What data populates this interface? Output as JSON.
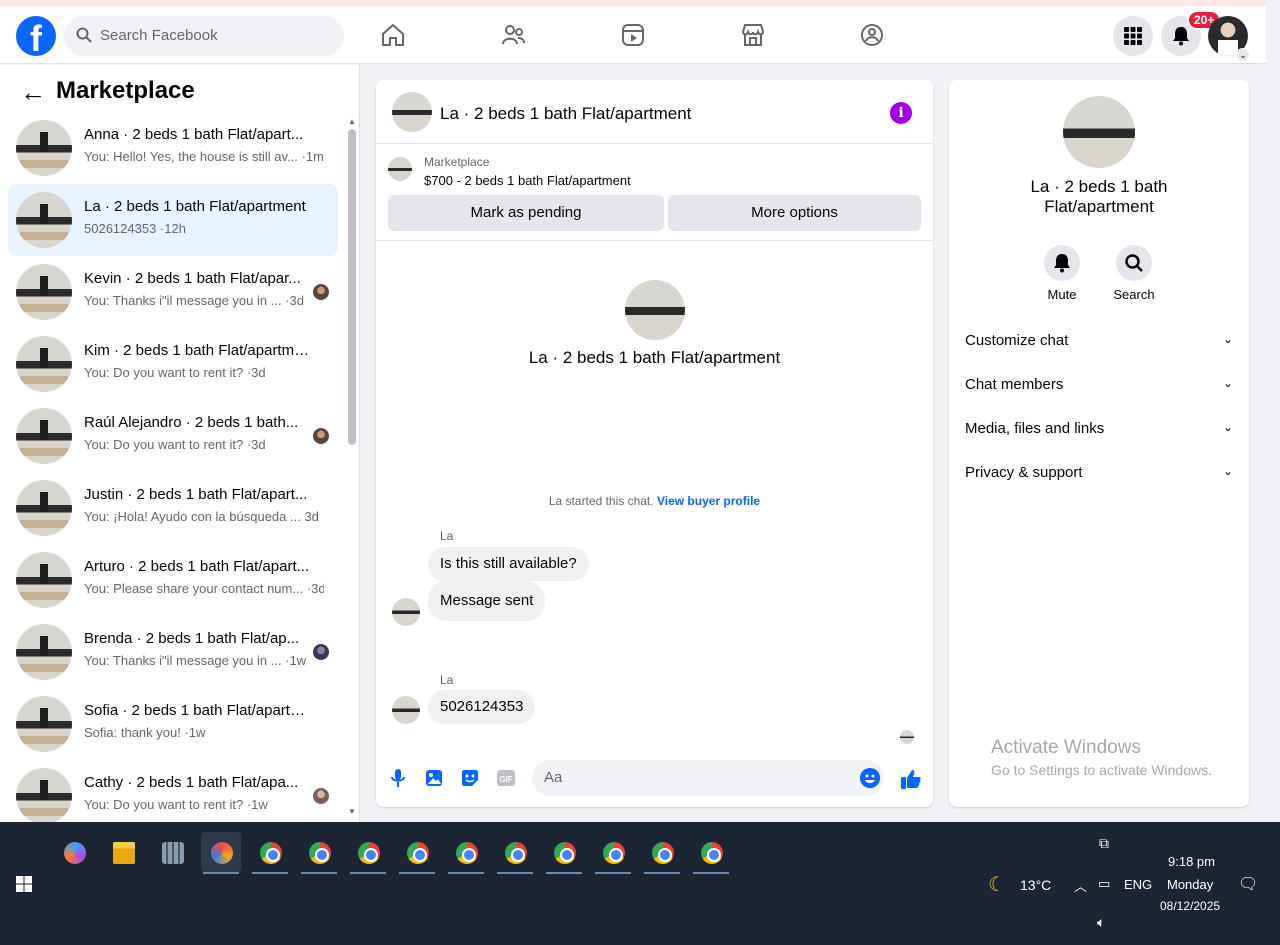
{
  "header": {
    "logo": "f",
    "search_placeholder": "Search Facebook",
    "nav_icons": [
      "home-icon",
      "friends-icon",
      "video-icon",
      "marketplace-icon",
      "groups-icon"
    ],
    "notification_badge": "20+",
    "accent": "#0866ff"
  },
  "sidebar": {
    "title": "Marketplace",
    "conversations": [
      {
        "name": "Anna · 2 beds 1 bath Flat/apart...",
        "preview": "You: Hello! Yes, the house is still av... ·1m",
        "active": false
      },
      {
        "name": "La · 2 beds 1 bath Flat/apartment",
        "preview": "5026124353 ·12h",
        "active": true
      },
      {
        "name": "Kevin · 2 beds 1 bath Flat/apar...",
        "preview": "You: Thanks i\"il message you in ... ·3d",
        "active": false
      },
      {
        "name": "Kim · 2 beds 1 bath Flat/apartme...",
        "preview": "You: Do you want to rent it? ·3d",
        "active": false
      },
      {
        "name": "Raúl Alejandro · 2 beds 1 bath...",
        "preview": "You: Do you want to rent it? ·3d",
        "active": false
      },
      {
        "name": "Justin · 2 beds 1 bath Flat/apart...",
        "preview": "You: ¡Hola! Ayudo con la búsqueda ... 3d",
        "active": false
      },
      {
        "name": "Arturo · 2 beds 1 bath Flat/apart...",
        "preview": "You: Please share your contact num... ·3d",
        "active": false
      },
      {
        "name": "Brenda · 2 beds 1 bath Flat/ap...",
        "preview": "You: Thanks i\"il message you in ... ·1w",
        "active": false
      },
      {
        "name": "Sofia · 2 beds 1 bath Flat/apartm...",
        "preview": "Sofia: thank you! ·1w",
        "active": false
      },
      {
        "name": "Cathy · 2 beds 1 bath Flat/apa...",
        "preview": "You: Do you want to rent it? ·1w",
        "active": false
      }
    ]
  },
  "chat": {
    "title": "La · 2 beds 1 bath Flat/apartment",
    "marketplace_label": "Marketplace",
    "listing": "$700 - 2 beds 1 bath Flat/apartment",
    "mark_pending": "Mark as pending",
    "more_options": "More options",
    "header_title": "La · 2 beds 1 bath Flat/apartment",
    "started_text": "La started this chat.",
    "buyer_profile_link": "View buyer profile",
    "sender_1": "La",
    "msg_1": "Is this still available?",
    "msg_2": "Message sent",
    "sender_2": "La",
    "msg_3": "5026124353",
    "input_placeholder": "Aa",
    "composer_icons": [
      "microphone-icon",
      "image-icon",
      "sticker-icon",
      "gif-icon",
      "emoji-icon",
      "like-icon"
    ]
  },
  "info": {
    "title": "La · 2 beds 1 bath Flat/apartment",
    "mute": "Mute",
    "search": "Search",
    "sections": [
      "Customize chat",
      "Chat members",
      "Media, files and links",
      "Privacy & support"
    ]
  },
  "watermark": {
    "line1": "Activate Windows",
    "line2": "Go to Settings to activate Windows."
  },
  "taskbar": {
    "weather": "13°C",
    "lang": "ENG",
    "time": "9:18 pm",
    "day": "Monday",
    "date": "08/12/2025"
  }
}
